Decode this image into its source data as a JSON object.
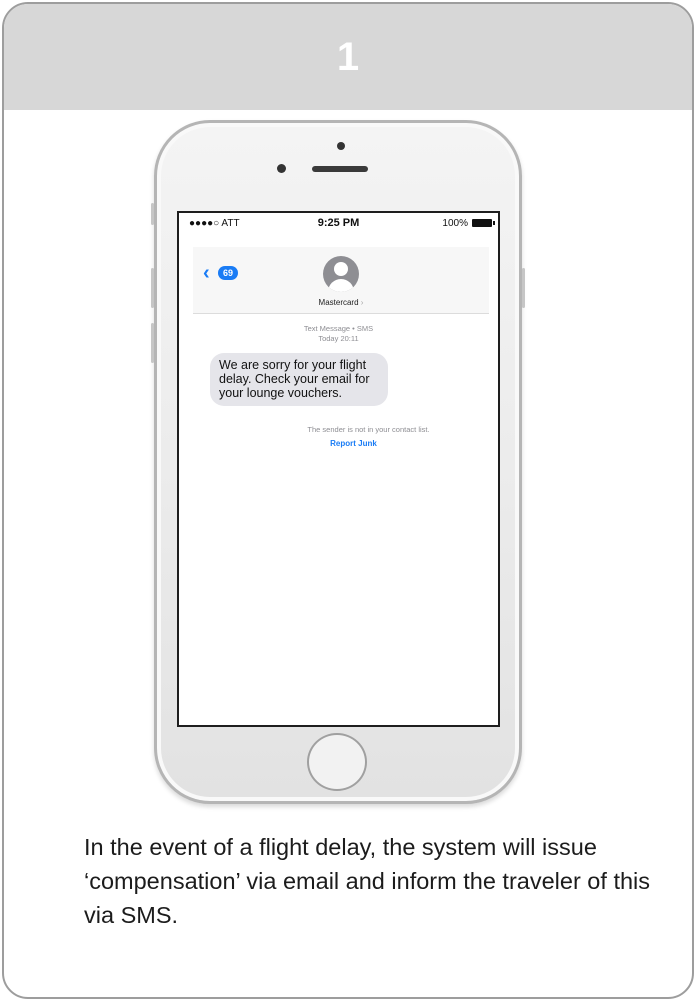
{
  "card": {
    "step_number": "1"
  },
  "phone": {
    "status_bar": {
      "carrier": "●●●●○ ATT",
      "time": "9:25 PM",
      "battery": "100%"
    },
    "nav": {
      "back_count": "69",
      "contact_name": "Mastercard"
    },
    "thread_meta": {
      "type": "Text Message • SMS",
      "timestamp": "Today 20:11"
    },
    "message": {
      "text": "We are sorry for your flight delay. Check your email for your lounge vouchers."
    },
    "notice": {
      "text": "The sender is not in your contact list.",
      "report_label": "Report Junk"
    }
  },
  "caption": {
    "text": "In the event of a flight delay, the system will issue ‘compensation’ via email and inform the traveler of this via SMS."
  },
  "colors": {
    "accent": "#1a7cf5",
    "header_bg": "#d7d7d7",
    "bubble": "#e5e5ea"
  }
}
